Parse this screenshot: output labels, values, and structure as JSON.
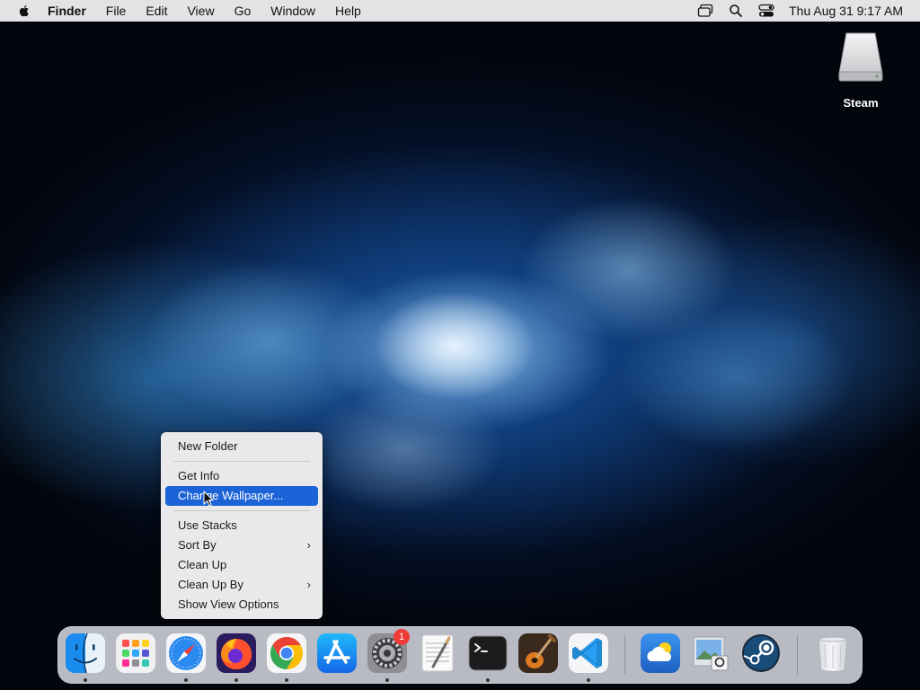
{
  "menubar": {
    "app_name": "Finder",
    "items": [
      "File",
      "Edit",
      "View",
      "Go",
      "Window",
      "Help"
    ],
    "clock": "Thu Aug 31  9:17 AM"
  },
  "desktop": {
    "icons": [
      {
        "label": "Steam",
        "icon": "drive-icon"
      }
    ]
  },
  "context_menu": {
    "items": [
      {
        "label": "New Folder"
      },
      {
        "label": "Get Info"
      },
      {
        "label": "Change Wallpaper...",
        "highlighted": true
      },
      {
        "label": "Use Stacks"
      },
      {
        "label": "Sort By",
        "submenu": true
      },
      {
        "label": "Clean Up"
      },
      {
        "label": "Clean Up By",
        "submenu": true
      },
      {
        "label": "Show View Options"
      }
    ],
    "chevron": "›"
  },
  "dock": {
    "apps": [
      {
        "icon": "finder-icon",
        "running": true
      },
      {
        "icon": "launchpad-icon",
        "running": false
      },
      {
        "icon": "safari-icon",
        "running": true
      },
      {
        "icon": "firefox-icon",
        "running": true
      },
      {
        "icon": "chrome-icon",
        "running": true
      },
      {
        "icon": "app-store-icon",
        "running": false
      },
      {
        "icon": "system-settings-icon",
        "running": true,
        "badge": "1"
      },
      {
        "icon": "textedit-icon",
        "running": false
      },
      {
        "icon": "terminal-icon",
        "running": true
      },
      {
        "icon": "garageband-icon",
        "running": false
      },
      {
        "icon": "vscode-icon",
        "running": true
      },
      {
        "icon": "weather-icon",
        "running": false
      },
      {
        "icon": "preview-icon",
        "running": false
      },
      {
        "icon": "steam-icon",
        "running": false
      },
      {
        "icon": "trash-icon",
        "running": false
      }
    ],
    "accent_colors": {
      "highlight": "#1b63d6",
      "badge": "#ef3b35"
    }
  }
}
